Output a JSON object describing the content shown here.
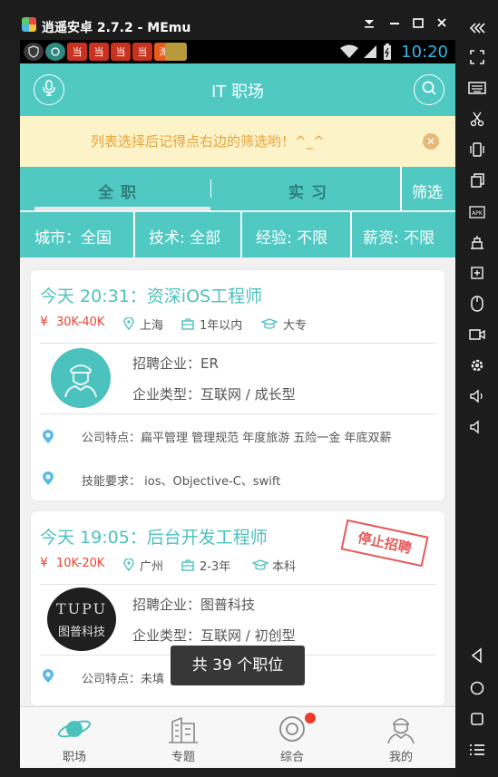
{
  "window": {
    "title": "逍遥安卓 2.7.2 - MEmu"
  },
  "statusbar": {
    "time": "10:20",
    "notifications": [
      "当",
      "当",
      "当",
      "当",
      "淘"
    ]
  },
  "appbar": {
    "title": "IT 职场"
  },
  "tip": {
    "text": "列表选择后记得点右边的筛选哟！^_^"
  },
  "tabs": {
    "full_time": "全职",
    "internship": "实习",
    "filter": "筛选",
    "active": "full_time"
  },
  "filters": {
    "city": "城市：全国",
    "tech": "技术: 全部",
    "experience": "经验: 不限",
    "salary": "薪资: 不限"
  },
  "jobs": [
    {
      "title": "今天 20:31：资深iOS工程师",
      "salary": "30K-40K",
      "city": "上海",
      "experience": "1年以内",
      "education": "大专",
      "company": "招聘企业：ER",
      "company_type": "企业类型：互联网 / 成长型",
      "features": "公司特点：扁平管理 管理规范 年度旅游 五险一金 年底双薪",
      "skills": "技能要求： ios、Objective-C、swift",
      "stopped": false
    },
    {
      "title": "今天 19:05：后台开发工程师",
      "salary": "10K-20K",
      "city": "广州",
      "experience": "2-3年",
      "education": "本科",
      "company": "招聘企业：图普科技",
      "company_type": "企业类型：互联网 / 初创型",
      "features": "公司特点：未填",
      "logo_text": "TUPU",
      "logo_sub": "图普科技",
      "stamp": "停止招聘",
      "stopped": true
    }
  ],
  "toast": {
    "text": "共 39 个职位"
  },
  "bottom_nav": [
    {
      "label": "职场",
      "icon": "planet-icon",
      "active": true
    },
    {
      "label": "专题",
      "icon": "building-icon",
      "active": false
    },
    {
      "label": "综合",
      "icon": "at-icon",
      "active": false,
      "badge": true
    },
    {
      "label": "我的",
      "icon": "person-icon",
      "active": false
    }
  ],
  "colors": {
    "accent": "#50c9c3",
    "salary": "#f0412f",
    "tip_text": "#e8a23a",
    "stamp": "#e04848"
  }
}
